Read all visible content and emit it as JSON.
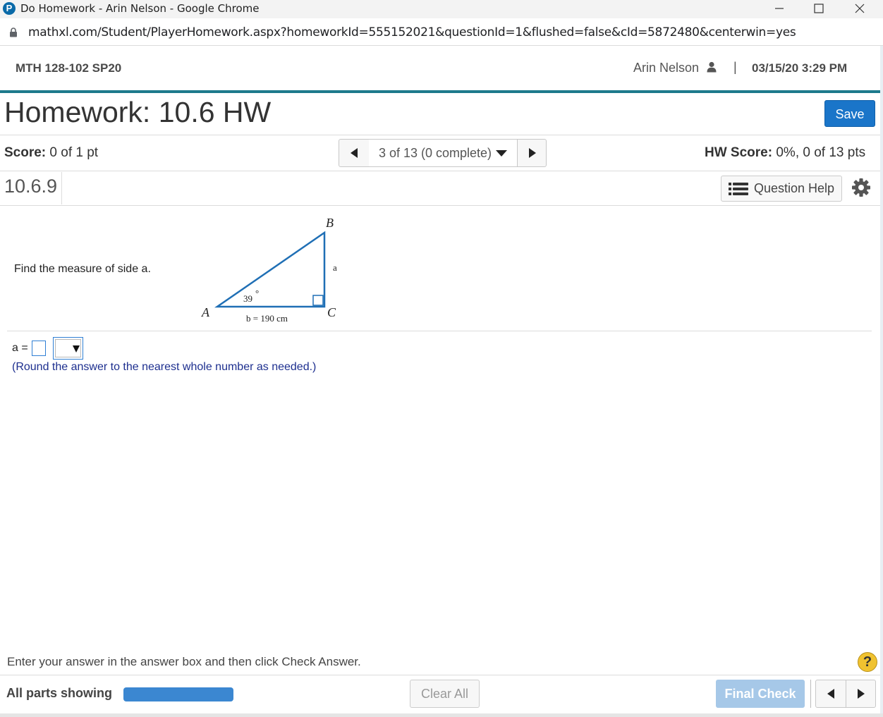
{
  "window": {
    "title": "Do Homework - Arin Nelson - Google Chrome",
    "favicon_letter": "P"
  },
  "address_bar": {
    "url": "mathxl.com/Student/PlayerHomework.aspx?homeworkId=555152021&questionId=1&flushed=false&cId=5872480&centerwin=yes"
  },
  "header": {
    "course": "MTH 128-102 SP20",
    "user": "Arin Nelson",
    "separator": "|",
    "datetime": "03/15/20 3:29 PM"
  },
  "homework": {
    "title": "Homework: 10.6 HW",
    "save_label": "Save"
  },
  "score_row": {
    "score_label": "Score:",
    "score_value": "0 of 1 pt",
    "nav_label": "3 of 13 (0 complete)",
    "hw_score_label": "HW Score:",
    "hw_score_value": "0%, 0 of 13 pts"
  },
  "question": {
    "number": "10.6.9",
    "help_label": "Question Help",
    "prompt": "Find the measure of side a.",
    "figure": {
      "vertex_a": "A",
      "vertex_b": "B",
      "vertex_c": "C",
      "side_a": "a",
      "angle": "39",
      "degree": "°",
      "side_b": "b = 190 cm"
    },
    "answer_label": "a =",
    "answer_value": "",
    "note": "(Round the answer to the nearest whole number as needed.)"
  },
  "footer": {
    "instructions": "Enter your answer in the answer box and then click Check Answer.",
    "help_symbol": "?",
    "all_parts": "All parts showing",
    "progress": 1.0,
    "clear_all": "Clear All",
    "final_check": "Final Check"
  },
  "colors": {
    "accent_teal": "#1d7a8c",
    "save_blue": "#1a75c9",
    "triangle_blue": "#1f6fb5",
    "note_navy": "#1d2f8f"
  },
  "icons": [
    "minimize-icon",
    "maximize-icon",
    "close-icon",
    "lock-icon",
    "user-icon",
    "caret-left-icon",
    "caret-right-icon",
    "caret-down-icon",
    "list-icon",
    "gear-icon",
    "help-icon"
  ]
}
